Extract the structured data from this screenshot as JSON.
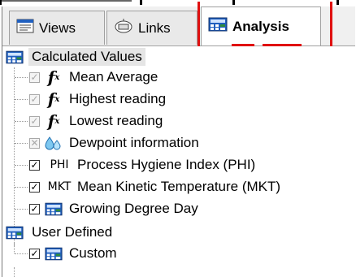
{
  "tabs": [
    {
      "label": "Views",
      "icon": "views-icon"
    },
    {
      "label": "Links",
      "icon": "links-icon"
    },
    {
      "label": "Analysis",
      "icon": "calculator-icon",
      "active": true
    }
  ],
  "tree": {
    "groups": [
      {
        "label": "Calculated Values",
        "icon": "calculator-icon",
        "items": [
          {
            "label": "Mean Average",
            "checked": true,
            "enabled": false,
            "icon": "function-icon"
          },
          {
            "label": "Highest reading",
            "checked": true,
            "enabled": false,
            "icon": "function-icon"
          },
          {
            "label": "Lowest reading",
            "checked": true,
            "enabled": false,
            "icon": "function-icon"
          },
          {
            "label": "Dewpoint information",
            "checked": false,
            "enabled": false,
            "icon": "water-drops-icon"
          },
          {
            "label": "Process Hygiene Index (PHI)",
            "checked": true,
            "enabled": true,
            "icon_text": "PHI"
          },
          {
            "label": "Mean Kinetic Temperature (MKT)",
            "checked": true,
            "enabled": true,
            "icon_text": "MKT"
          },
          {
            "label": "Growing Degree Day",
            "checked": true,
            "enabled": true,
            "icon": "calculator-icon"
          }
        ]
      },
      {
        "label": "User Defined",
        "icon": "calculator-icon",
        "items": [
          {
            "label": "Custom",
            "checked": true,
            "enabled": true,
            "icon": "calculator-icon"
          }
        ]
      }
    ]
  },
  "colors": {
    "highlight": "#e01010",
    "icon_blue": "#1f5fbf",
    "icon_green": "#2e8b3a"
  }
}
